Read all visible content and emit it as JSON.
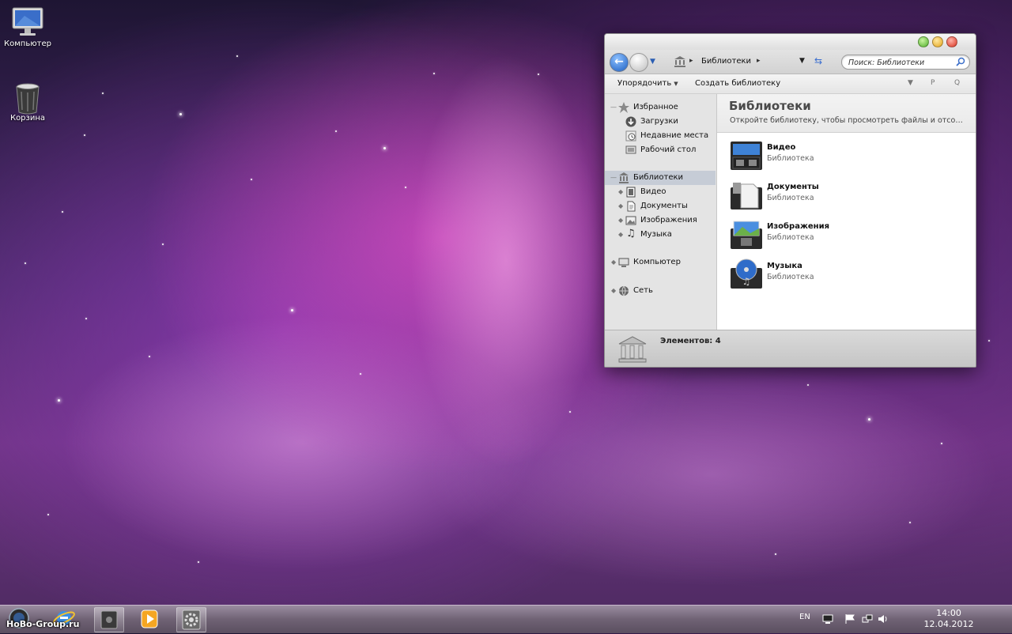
{
  "desktop": {
    "icons": [
      {
        "label": "Компьютер"
      },
      {
        "label": "Корзина"
      }
    ]
  },
  "window": {
    "address": {
      "crumb": "Библиотеки"
    },
    "search": {
      "placeholder": "Поиск: Библиотеки"
    },
    "toolbar": {
      "organize": "Упорядочить",
      "create": "Создать библиотеку"
    },
    "nav": {
      "favorites": "Избранное",
      "downloads": "Загрузки",
      "recent": "Недавние места",
      "desktop": "Рабочий стол",
      "libraries": "Библиотеки",
      "video": "Видео",
      "documents": "Документы",
      "images": "Изображения",
      "music": "Музыка",
      "computer": "Компьютер",
      "network": "Сеть"
    },
    "content": {
      "title": "Библиотеки",
      "subtitle": "Откройте библиотеку, чтобы просмотреть файлы и отсортировать их",
      "items": [
        {
          "name": "Видео",
          "type": "Библиотека"
        },
        {
          "name": "Документы",
          "type": "Библиотека"
        },
        {
          "name": "Изображения",
          "type": "Библиотека"
        },
        {
          "name": "Музыка",
          "type": "Библиотека"
        }
      ]
    },
    "status": {
      "count": "Элементов: 4"
    }
  },
  "taskbar": {
    "watermark": "HoBo-Group.ru",
    "lang": "EN",
    "time": "14:00",
    "date": "12.04.2012"
  },
  "colors": {
    "selection": "#c6ccd6",
    "accent_blue": "#1c5fc2"
  }
}
